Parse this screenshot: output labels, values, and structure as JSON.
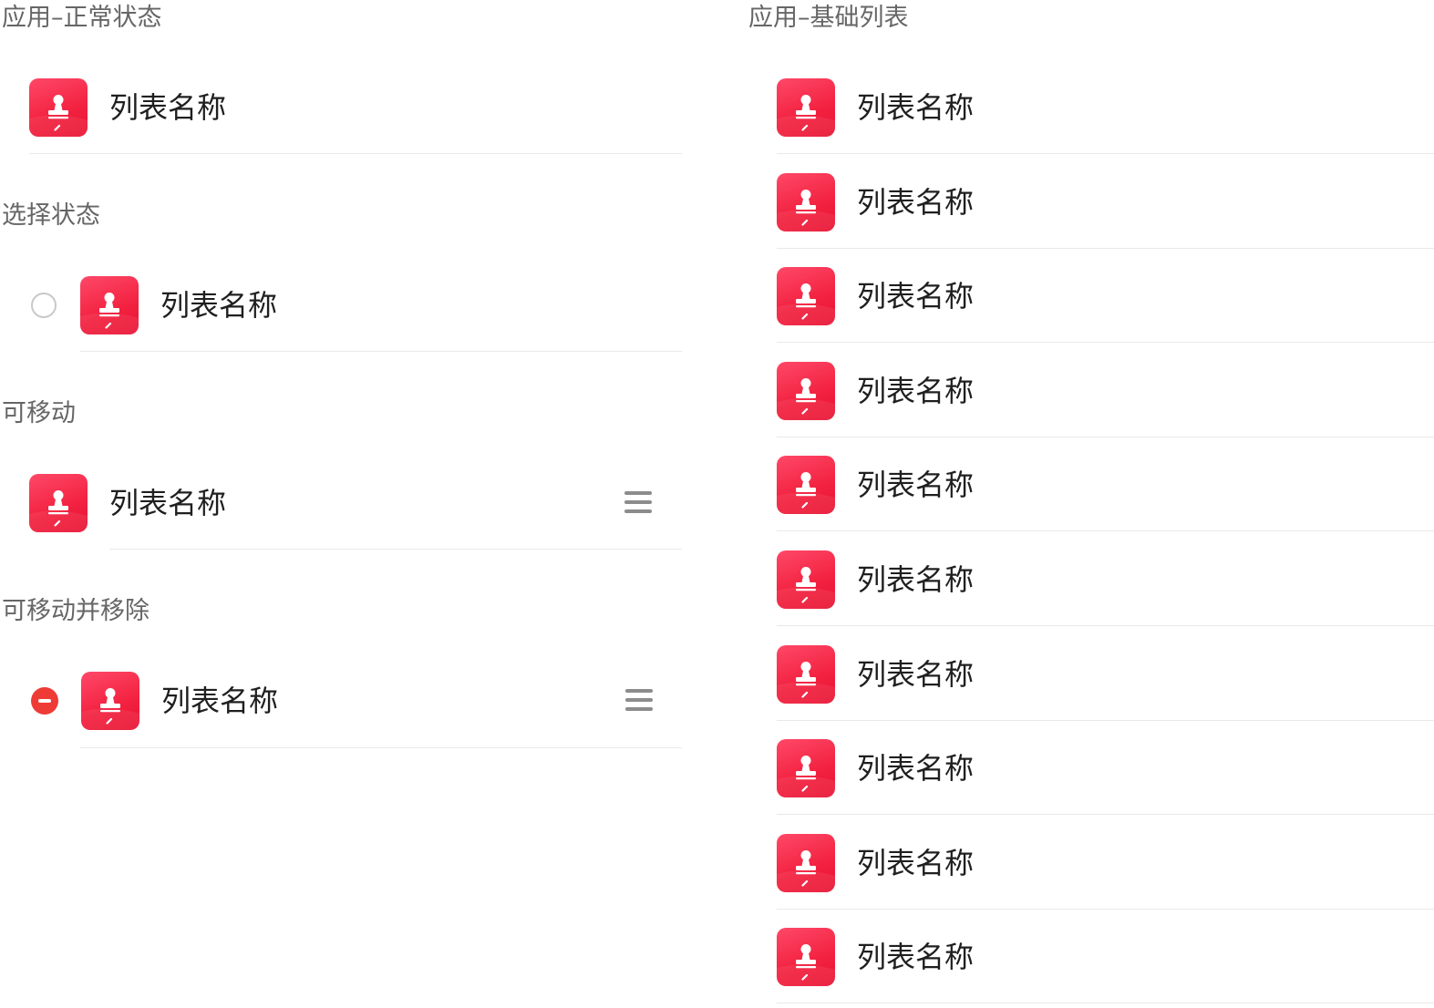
{
  "left_panel": {
    "sections": [
      {
        "title": "应用–正常状态",
        "variant": "normal",
        "item": {
          "label": "列表名称",
          "icon": "stamp-app-icon"
        }
      },
      {
        "title": "选择状态",
        "variant": "selectable",
        "item": {
          "label": "列表名称",
          "icon": "stamp-app-icon",
          "leading_control": "radio-unchecked-icon"
        }
      },
      {
        "title": "可移动",
        "variant": "movable",
        "item": {
          "label": "列表名称",
          "icon": "stamp-app-icon",
          "trailing_control": "drag-handle-icon"
        }
      },
      {
        "title": "可移动并移除",
        "variant": "movable-removable",
        "item": {
          "label": "列表名称",
          "icon": "stamp-app-icon",
          "leading_control": "remove-circle-icon",
          "trailing_control": "drag-handle-icon"
        }
      }
    ]
  },
  "right_panel": {
    "title": "应用–基础列表",
    "items": [
      {
        "label": "列表名称",
        "icon": "stamp-app-icon"
      },
      {
        "label": "列表名称",
        "icon": "stamp-app-icon"
      },
      {
        "label": "列表名称",
        "icon": "stamp-app-icon"
      },
      {
        "label": "列表名称",
        "icon": "stamp-app-icon"
      },
      {
        "label": "列表名称",
        "icon": "stamp-app-icon"
      },
      {
        "label": "列表名称",
        "icon": "stamp-app-icon"
      },
      {
        "label": "列表名称",
        "icon": "stamp-app-icon"
      },
      {
        "label": "列表名称",
        "icon": "stamp-app-icon"
      },
      {
        "label": "列表名称",
        "icon": "stamp-app-icon"
      },
      {
        "label": "列表名称",
        "icon": "stamp-app-icon"
      }
    ]
  },
  "colors": {
    "icon_gradient_start": "#ff4868",
    "icon_gradient_end": "#e81434",
    "remove_red": "#ee3b36",
    "section_title_gray": "#666666",
    "divider_gray": "#e9e9e9",
    "handle_gray": "#8c8c8c"
  }
}
